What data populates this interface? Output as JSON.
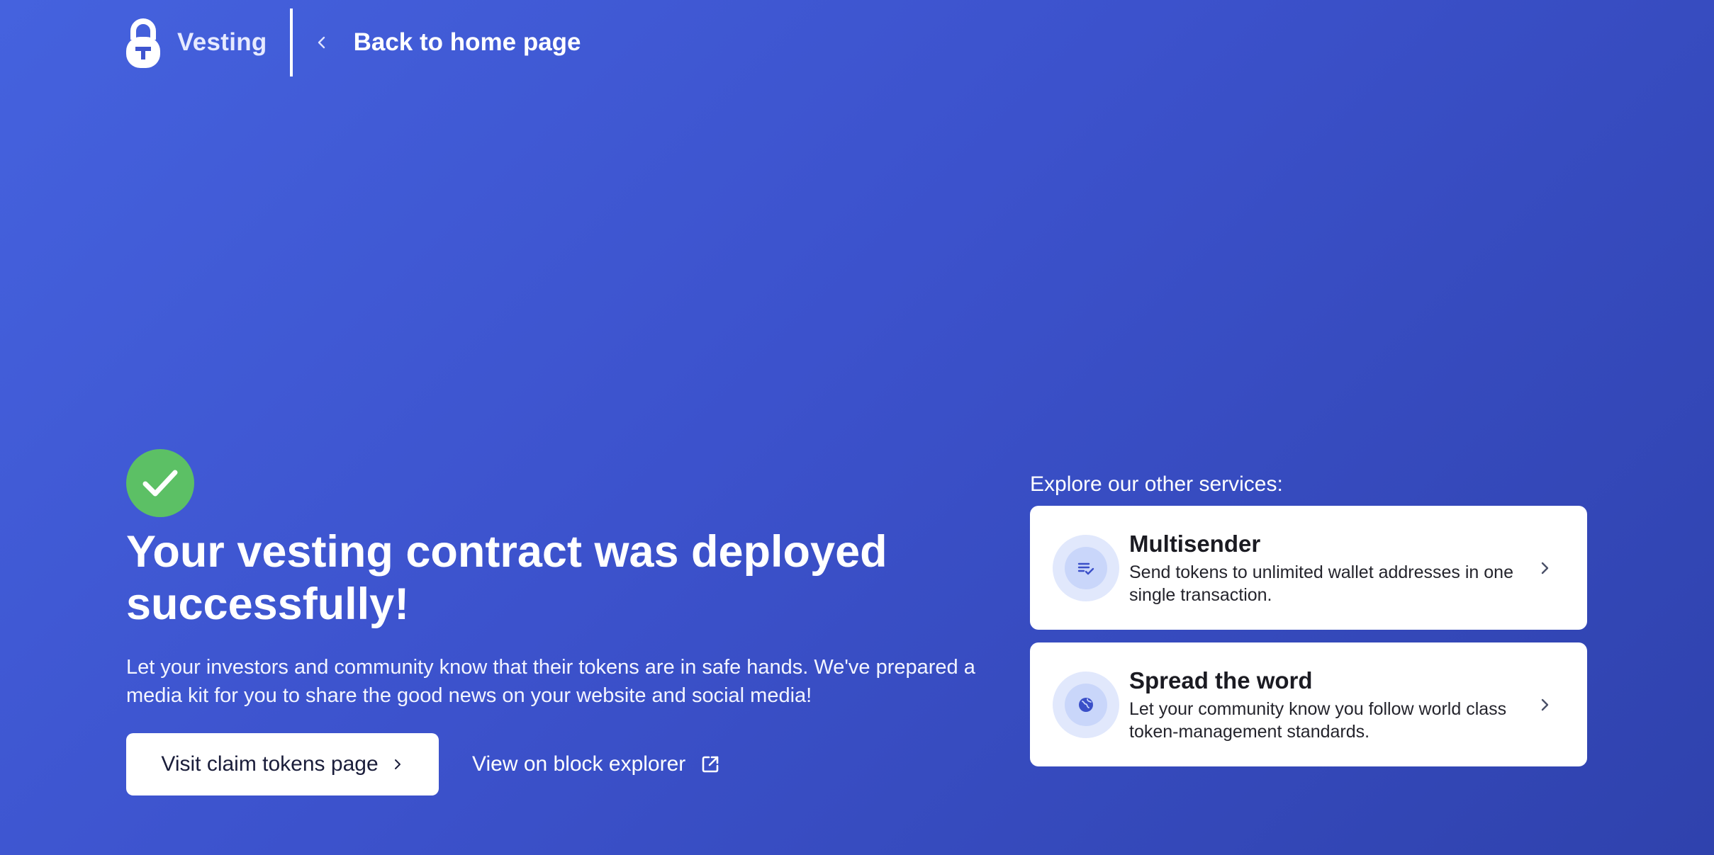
{
  "header": {
    "brand_name": "Vesting",
    "back_label": "Back to home page"
  },
  "main": {
    "headline": "Your vesting contract was deployed successfully!",
    "subtext": "Let your investors and community know that their tokens are in safe hands. We've prepared a media kit for you to share the good news on your website and social media!",
    "primary_button_label": "Visit claim tokens page",
    "explorer_link_label": "View on block explorer"
  },
  "services": {
    "title": "Explore our other services:",
    "items": [
      {
        "title": "Multisender",
        "description": "Send tokens to unlimited wallet addresses in one single transaction.",
        "icon": "list-check-icon"
      },
      {
        "title": "Spread the word",
        "description": "Let your community know you follow world class token-management standards.",
        "icon": "globe-icon"
      }
    ]
  },
  "colors": {
    "background_start": "#4562de",
    "background_end": "#2f42ad",
    "success": "#5cc065",
    "card": "#ffffff",
    "icon_accent": "#3a4fc8"
  }
}
